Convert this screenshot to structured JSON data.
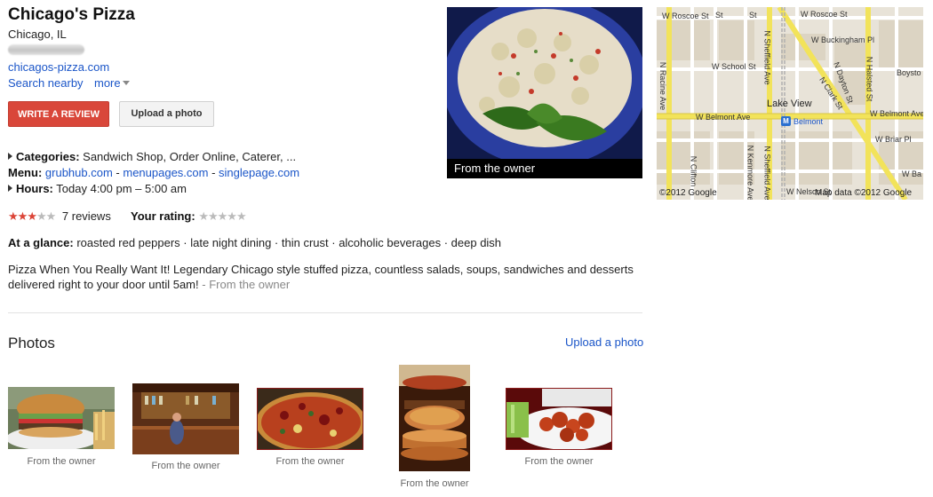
{
  "business": {
    "name": "Chicago's Pizza",
    "city": "Chicago, IL",
    "website": "chicagos-pizza.com",
    "search_nearby": "Search nearby",
    "more": "more"
  },
  "actions": {
    "write_review": "WRITE A REVIEW",
    "upload_photo": "Upload a photo"
  },
  "details": {
    "categories_label": "Categories:",
    "categories_value": "Sandwich Shop, Order Online, Caterer, ...",
    "menu_label": "Menu:",
    "menu_links": [
      "grubhub.com",
      "menupages.com",
      "singlepage.com"
    ],
    "menu_sep": " - ",
    "hours_label": "Hours:",
    "hours_value": "Today 4:00 pm – 5:00 am"
  },
  "rating": {
    "stars": 3,
    "max_stars": 5,
    "reviews": "7 reviews",
    "your_rating_label": "Your rating:"
  },
  "glance": {
    "label": "At a glance:",
    "items": [
      "roasted red peppers",
      "late night dining",
      "thin crust",
      "alcoholic beverages",
      "deep dish"
    ],
    "sep": " · "
  },
  "description": {
    "text": "Pizza When You Really Want It! Legendary Chicago style stuffed pizza, countless salads, soups, sandwiches and desserts delivered right to your door until 5am!",
    "sep": " - ",
    "source": "From the owner"
  },
  "main_photo": {
    "caption": "From the owner"
  },
  "photos": {
    "heading": "Photos",
    "upload_link": "Upload a photo",
    "items": [
      {
        "caption": "From the owner",
        "subject": "burger"
      },
      {
        "caption": "From the owner",
        "subject": "bar-interior"
      },
      {
        "caption": "From the owner",
        "subject": "pizza"
      },
      {
        "caption": "From the owner",
        "subject": "deep-dish-stack"
      },
      {
        "caption": "From the owner",
        "subject": "chicken-wings"
      }
    ]
  },
  "map": {
    "streets": {
      "roscoe_w": "W Roscoe St",
      "roscoe_e": "W Roscoe St",
      "buckingham": "W Buckingham Pl",
      "school": "W School St",
      "boyston": "Boysto",
      "belmont_w": "W Belmont Ave",
      "belmont_e": "W Belmont Ave",
      "briar": "W Briar Pl",
      "ba": "W Ba",
      "nelson": "W Nelson St",
      "racine": "N Racine Ave",
      "sheffield_n": "N Sheffield Ave",
      "sheffield_s": "N Sheffield Ave",
      "halsted": "N Halsted St",
      "clark": "N Clark St",
      "dayton": "N Dayton St",
      "clifton": "N Clifton",
      "kenmore": "N Kenmore Ave",
      "st_left": "St",
      "st_mid": "St"
    },
    "neighborhood": "Lake View",
    "station": "Belmont",
    "station_badge": "M",
    "copyright": "©2012 Google",
    "map_data": "Map data ©2012 Google"
  },
  "colors": {
    "accent_red": "#d9473a",
    "link_blue": "#1a55c8",
    "map_major_road": "#f2e35a"
  }
}
